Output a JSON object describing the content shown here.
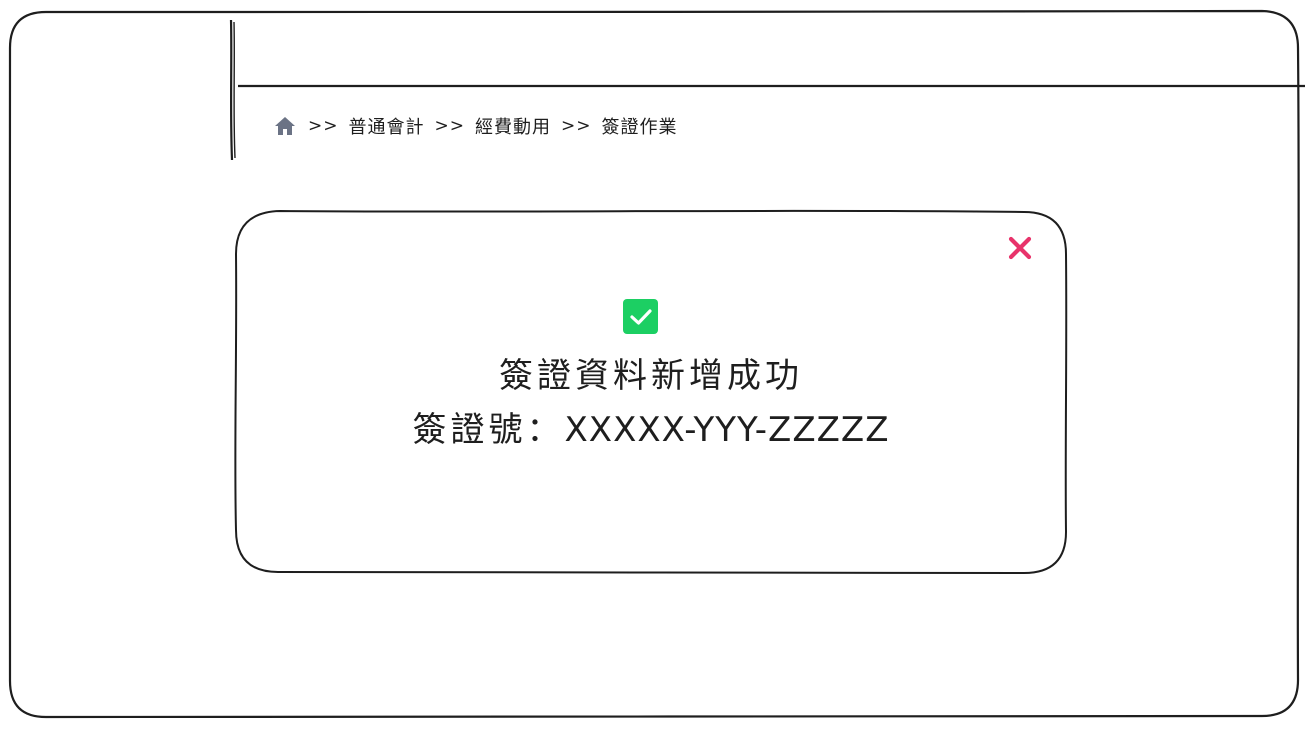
{
  "breadcrumb": {
    "home_icon": "home-icon",
    "separator": ">>",
    "items": [
      "普通會計",
      "經費動用",
      "簽證作業"
    ]
  },
  "dialog": {
    "close_icon": "close-icon",
    "close_color": "#e8336b",
    "success_icon": "check-icon",
    "success_color": "#1ccf63",
    "title": "簽證資料新增成功",
    "number_label": "簽證號：",
    "number_value": "XXXXX-YYY-ZZZZZ"
  }
}
